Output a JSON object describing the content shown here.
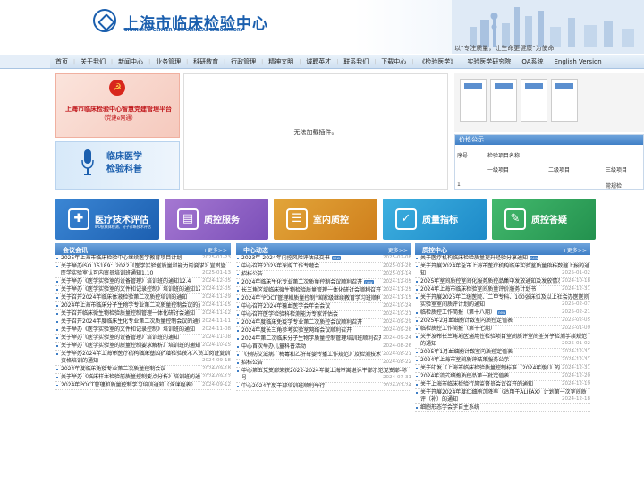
{
  "header": {
    "title_cn": "上海市临床检验中心",
    "title_en": "SHANGHAI CENTER FOR CLINICAL LABORATORY",
    "slogan": "以\"专注质量，让生命更健康\"为使命"
  },
  "colors": {
    "brand": "#1b5fae",
    "section_header": "#3f7fc6",
    "party_red": "#c0161a"
  },
  "nav": {
    "left_label": "首页",
    "items": [
      "关于我们",
      "新闻中心",
      "业务管理",
      "科研教育",
      "行政管理",
      "精神文明",
      "诚聘英才",
      "联系我们",
      "下载中心",
      "《检验医学》",
      "实验医学研究院",
      "OA系统",
      "English Version"
    ]
  },
  "banner": {
    "party_title": "上海市临床检验中心智慧党建管理平台",
    "party_sub": "（党建e网通）",
    "science_line1": "临床医学",
    "science_line2": "检验科普"
  },
  "plugin_message": "无法加载插件。",
  "price": {
    "title": "价格公示",
    "col_no": "序号",
    "col_name": "检验项目名称",
    "level1": "一级项目",
    "level2": "二级项目",
    "level3": "三级项目",
    "row_no": "1",
    "row_item": "常规检"
  },
  "tiles": [
    {
      "label": "医疗技术评估",
      "sub": "IPO抗核体检测、分子诊断技术评估",
      "icon": "hospital-icon"
    },
    {
      "label": "质控服务",
      "sub": "",
      "icon": "clipboard-icon"
    },
    {
      "label": "室内质控",
      "sub": "",
      "icon": "document-icon"
    },
    {
      "label": "质量指标",
      "sub": "",
      "icon": "shield-check-icon"
    },
    {
      "label": "质控答疑",
      "sub": "",
      "icon": "chat-icon"
    }
  ],
  "columns": [
    {
      "title": "会议会讯",
      "more": "+更多>>",
      "items": [
        {
          "text": "2025年上海市临床检验中心继续医学教育项目计划",
          "date": "2025-01-23"
        },
        {
          "text": "关于举办ISO 15189：2022《医学实验室质量和能力的要求》宣贯暨医学实验室认可内审员培训班通知1.10",
          "date": "2025-01-13"
        },
        {
          "text": "关于举办《医学实验室的设备管理》培训班的通知12.4",
          "date": "2024-12-05"
        },
        {
          "text": "关于举办《医学实验室的文件和记录控制》培训班的通知12.4",
          "date": "2024-12-05"
        },
        {
          "text": "关于召开2024年临床体液检验第二次质控培训的通知",
          "date": "2024-11-29"
        },
        {
          "text": "2024年上海市临床分子生物学专业第二次质量控制会议的通知",
          "date": "2024-11-15"
        },
        {
          "text": "关于召开临床微生物检验质量控制管理一体化研讨会通知",
          "date": "2024-11-12"
        },
        {
          "text": "关于召开2024年度临床生化专业第二次质量控制会议的通知",
          "date": "2024-11-11"
        },
        {
          "text": "关于举办《医学实验室的文件和记录控制》培训班的通知",
          "date": "2024-11-08"
        },
        {
          "text": "关于举办《医学实验室的设备管理》培训班的通知",
          "date": "2024-11-08"
        },
        {
          "text": "关于举办《医学实验室的质量控制要求解析》培训班的通知",
          "date": "2024-10-15"
        },
        {
          "text": "关于举办2024年上海市医疗机构临床基因扩增检验技术人员上岗证复训资格培训的通知",
          "date": "2024-09-18"
        },
        {
          "text": "2024年度临床免疫专业第二次质量控制会议",
          "date": "2024-09-18"
        },
        {
          "text": "关于举办《临床样本检验前质量控制要点分析》培训班的通知",
          "date": "2024-09-12"
        },
        {
          "text": "2024年POCT管理和质量控制学习培训通知（含课程表）",
          "date": "2024-09-12"
        }
      ]
    },
    {
      "title": "中心动态",
      "more": "+更多>>",
      "items": [
        {
          "text": "2023年-2024年内控风险评估成交书",
          "date": "2025-02-08",
          "badge": "new"
        },
        {
          "text": "中心召开2025年采购工作专题会",
          "date": "2025-01-26"
        },
        {
          "text": "招标公告",
          "date": "2025-01-14"
        },
        {
          "text": "2024年临床生化专业第二次质量控制会议顺利召开",
          "date": "2024-12-05",
          "badge": "new"
        },
        {
          "text": "长三角区域临床微生物检验质量管理一体化研讨会顺利召开",
          "date": "2024-11-25"
        },
        {
          "text": "2024年\"POCT管理和质量控制\"国家级继续教育学习班顺利召开",
          "date": "2024-11-15"
        },
        {
          "text": "中心召开2024年输血医学会年会会议",
          "date": "2024-10-24"
        },
        {
          "text": "中心召开医学检验科检测能力专家评估会",
          "date": "2024-10-21"
        },
        {
          "text": "2024年度临床免疫学专业第二次质控会议顺利召开",
          "date": "2024-09-29"
        },
        {
          "text": "2024年度长三角参考实验室网络会议顺利召开",
          "date": "2024-09-26"
        },
        {
          "text": "2024年第二次临床分子生物学质量控制管理培训班顺利召开",
          "date": "2024-09-24"
        },
        {
          "text": "中心首次举办儿童科普活动",
          "date": "2024-08-26"
        },
        {
          "text": "《预防艾滋病、梅毒和乙肝母婴传播工作规范》及检测技术规范等要求",
          "date": "2024-08-21"
        },
        {
          "text": "招标公告",
          "date": "2024-08-22"
        },
        {
          "text": "中心第五党支部荣获2022-2024年度上海市离退休干部示范党支部-称号",
          "date": "2024-07-31"
        },
        {
          "text": "中心2024年度干部培训班顺利举行",
          "date": "2024-07-24"
        }
      ]
    },
    {
      "title": "质控中心",
      "more": "+更多>>",
      "items": [
        {
          "text": "关于医疗机构临床检验质量提升经验分享通知",
          "date": "",
          "badge": "new"
        },
        {
          "text": "关于开展2024年全市上海市医疗机构临床实验室质量指标数据上报的通知",
          "date": "2025-01-02"
        },
        {
          "text": "2025年室间质控室间化服务质控品集中发放通知及发放情况(实时更新)",
          "date": "2024-10-18"
        },
        {
          "text": "2024年上海市临床检验室间质量评价服务计划书",
          "date": "2024-12-31"
        },
        {
          "text": "关于开展2025年二级医院、二甲专科、100张床位及以上社会办医医院实验室室间质评计划的通知",
          "date": "2025-02-07"
        },
        {
          "text": "临检质控工作简报（第十八期）",
          "date": "2025-02-21",
          "badge": "new"
        },
        {
          "text": "2025年2月血细胞计数室内质控定值表",
          "date": "2025-02-05"
        },
        {
          "text": "临检质控工作简报（第十七期）",
          "date": "2025-01-09"
        },
        {
          "text": "关于发布长三角地区通用性检验项目室间质评室间全分子检测手续规范的通知",
          "date": "2025-01-02"
        },
        {
          "text": "2025年1月血细胞计数室内质控定值表",
          "date": "2024-12-31"
        },
        {
          "text": "2024年上海市室间质评结果服务公示",
          "date": "2024-12-31"
        },
        {
          "text": "关于印发《上海市临床检验质量控制标准（2024年版）》的通知",
          "date": "2024-12-31"
        },
        {
          "text": "2024年流式细胞质控品第一批定值表",
          "date": "2024-12-20"
        },
        {
          "text": "关于上海市临床检验行风监督员会议召开的通知",
          "date": "2024-12-19"
        },
        {
          "text": "关于开展2024年度红细胞沉降率（适用于ALIFAX）计划第一次室间质评（补）的通知",
          "date": "2024-12-18"
        },
        {
          "text": "细胞形态学会学自主系统",
          "date": ""
        }
      ]
    }
  ]
}
